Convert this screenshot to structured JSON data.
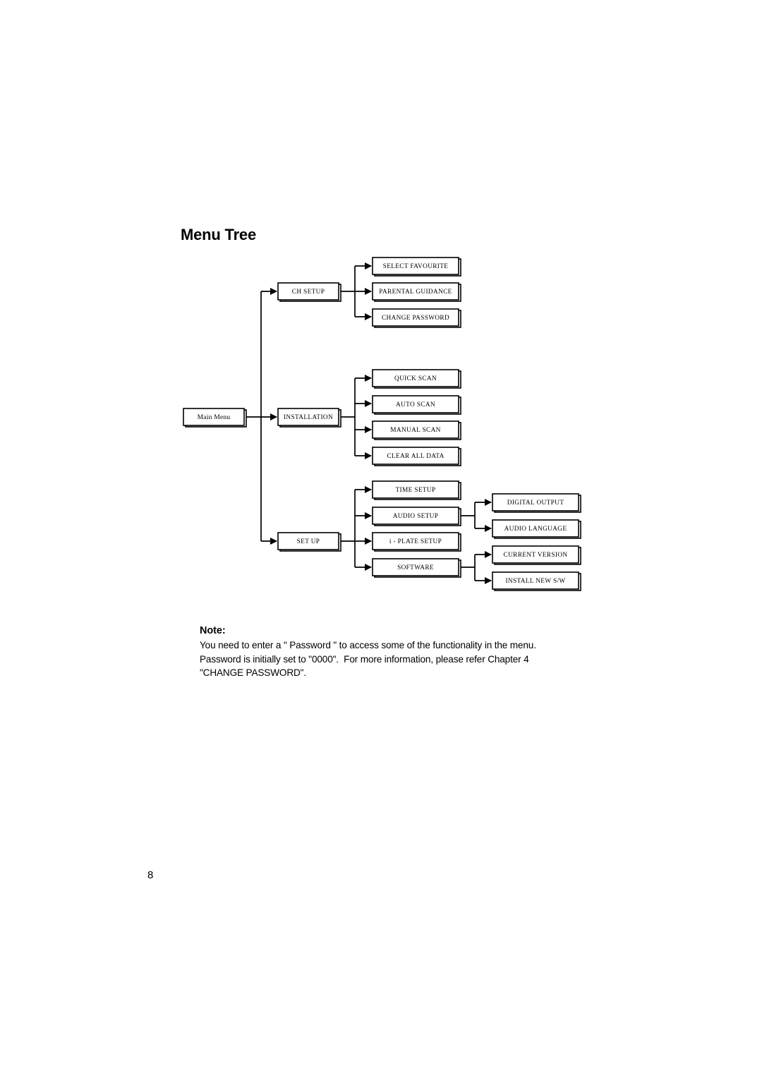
{
  "document": {
    "page_title": "Menu Tree",
    "page_number": "8"
  },
  "note": {
    "heading": "Note:",
    "lines": [
      "You need to enter a \" Password \" to access some of the functionality in the menu.",
      "Password is initially set to \"0000\".  For more information, please refer Chapter 4",
      "\"CHANGE PASSWORD\"."
    ]
  },
  "menu_tree": {
    "root": {
      "label": "Main Menu"
    },
    "level1": [
      {
        "label": "CH SETUP"
      },
      {
        "label": "INSTALLATION"
      },
      {
        "label": "SET UP"
      }
    ],
    "level2": {
      "ch_setup": [
        {
          "label": "SELECT FAVOURITE"
        },
        {
          "label": "PARENTAL GUIDANCE"
        },
        {
          "label": "CHANGE PASSWORD"
        }
      ],
      "installation": [
        {
          "label": "QUICK SCAN"
        },
        {
          "label": "AUTO SCAN"
        },
        {
          "label": "MANUAL SCAN"
        },
        {
          "label": "CLEAR ALL DATA"
        }
      ],
      "set_up": [
        {
          "label": "TIME SETUP"
        },
        {
          "label": "AUDIO SETUP"
        },
        {
          "label": "i - PLATE SETUP"
        },
        {
          "label": "SOFTWARE"
        }
      ]
    },
    "level3": {
      "audio_setup": [
        {
          "label": "DIGITAL OUTPUT"
        },
        {
          "label": "AUDIO LANGUAGE"
        }
      ],
      "software": [
        {
          "label": "CURRENT VERSION"
        },
        {
          "label": "INSTALL NEW S/W"
        }
      ]
    },
    "colors": {
      "box_fill": "#ffffff",
      "box_stroke": "#000000",
      "connector": "#000000"
    }
  }
}
